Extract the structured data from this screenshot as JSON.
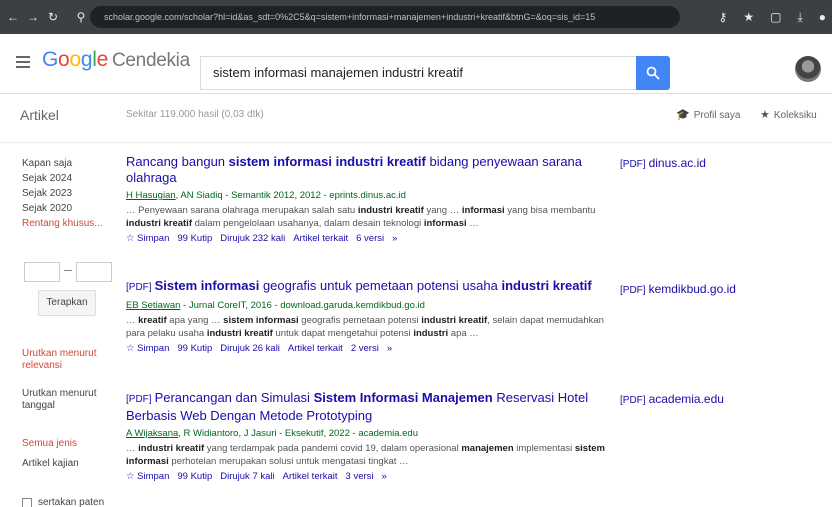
{
  "browser": {
    "url": "scholar.google.com/scholar?hl=id&as_sdt=0%2C5&q=sistem+informasi+manajemen+industri+kreatif&btnG=&oq=sis_id=15"
  },
  "header": {
    "logo": [
      "G",
      "o",
      "o",
      "g",
      "l",
      "e"
    ],
    "logo_suffix": "Cendekia",
    "search_query": "sistem informasi manajemen industri kreatif"
  },
  "subheader": {
    "section": "Artikel",
    "result_count": "Sekitar 119.000 hasil (0,03 dtk)",
    "profile": "Profil saya",
    "collections": "Koleksiku"
  },
  "sidebar": {
    "time_filters": [
      "Kapan saja",
      "Sejak 2024",
      "Sejak 2023",
      "Sejak 2020"
    ],
    "custom_range": "Rentang khusus...",
    "apply": "Terapkan",
    "sort_relevance": "Urutkan menurut relevansi",
    "sort_date": "Urutkan menurut tanggal",
    "any_language": "Semua jenis",
    "review_articles": "Artikel kajian",
    "include_patents": "sertakan paten"
  },
  "results": [
    {
      "pdf_prefix": "",
      "title_parts": [
        {
          "t": "Rancang bangun ",
          "b": false
        },
        {
          "t": "sistem informasi industri kreatif",
          "b": true
        },
        {
          "t": " bidang penyewaan sarana olahraga",
          "b": false
        }
      ],
      "authors_link": "H Hasugian",
      "authors_rest": ", AN Siadiq - Semantik 2012, 2012 - eprints.dinus.ac.id",
      "snippet_parts": [
        {
          "t": "… Penyewaan sarana olahraga merupakan salah satu ",
          "b": false
        },
        {
          "t": "industri kreatif",
          "b": true
        },
        {
          "t": " yang … ",
          "b": false
        },
        {
          "t": "informasi",
          "b": true
        },
        {
          "t": " yang bisa membantu ",
          "b": false
        },
        {
          "t": "industri kreatif",
          "b": true
        },
        {
          "t": " dalam pengelolaan usahanya, dalam desain teknologi ",
          "b": false
        },
        {
          "t": "informasi",
          "b": true
        },
        {
          "t": " …",
          "b": false
        }
      ],
      "actions": [
        "☆ Simpan",
        "99 Kutip",
        "Dirujuk 232 kali",
        "Artikel terkait",
        "6 versi",
        "»"
      ],
      "source_pdf": "[PDF]",
      "source": "dinus.ac.id"
    },
    {
      "pdf_prefix": "[PDF]",
      "title_parts": [
        {
          "t": "Sistem informasi",
          "b": true
        },
        {
          "t": " geografis untuk pemetaan potensi usaha ",
          "b": false
        },
        {
          "t": "industri kreatif",
          "b": true
        }
      ],
      "authors_link": "EB Setiawan",
      "authors_rest": " - Jurnal CoreIT, 2016 - download.garuda.kemdikbud.go.id",
      "snippet_parts": [
        {
          "t": "… ",
          "b": false
        },
        {
          "t": "kreatif",
          "b": true
        },
        {
          "t": " apa yang … ",
          "b": false
        },
        {
          "t": "sistem informasi",
          "b": true
        },
        {
          "t": " geografis pemetaan potensi ",
          "b": false
        },
        {
          "t": "industri kreatif",
          "b": true
        },
        {
          "t": ", selain dapat memudahkan para pelaku usaha ",
          "b": false
        },
        {
          "t": "industri kreatif",
          "b": true
        },
        {
          "t": " untuk dapat mengetahui potensi ",
          "b": false
        },
        {
          "t": "industri",
          "b": true
        },
        {
          "t": " apa …",
          "b": false
        }
      ],
      "actions": [
        "☆ Simpan",
        "99 Kutip",
        "Dirujuk 26 kali",
        "Artikel terkait",
        "2 versi",
        "»"
      ],
      "source_pdf": "[PDF]",
      "source": "kemdikbud.go.id"
    },
    {
      "pdf_prefix": "[PDF]",
      "title_parts": [
        {
          "t": "Perancangan dan Simulasi ",
          "b": false
        },
        {
          "t": "Sistem Informasi Manajemen",
          "b": true
        },
        {
          "t": " Reservasi Hotel Berbasis Web Dengan Metode Prototyping",
          "b": false
        }
      ],
      "authors_link": "A Wijaksana",
      "authors_rest": ", R Widiantoro, J Jasuri - Eksekutif, 2022 - academia.edu",
      "snippet_parts": [
        {
          "t": "… ",
          "b": false
        },
        {
          "t": "industri kreatif",
          "b": true
        },
        {
          "t": " yang terdampak pada pandemi covid 19, dalam operasional ",
          "b": false
        },
        {
          "t": "manajemen",
          "b": true
        },
        {
          "t": " implementasi ",
          "b": false
        },
        {
          "t": "sistem informasi",
          "b": true
        },
        {
          "t": " perhotelan merupakan solusi untuk mengatasi tingkat …",
          "b": false
        }
      ],
      "actions": [
        "☆ Simpan",
        "99 Kutip",
        "Dirujuk 7 kali",
        "Artikel terkait",
        "3 versi",
        "»"
      ],
      "source_pdf": "[PDF]",
      "source": "academia.edu"
    }
  ]
}
